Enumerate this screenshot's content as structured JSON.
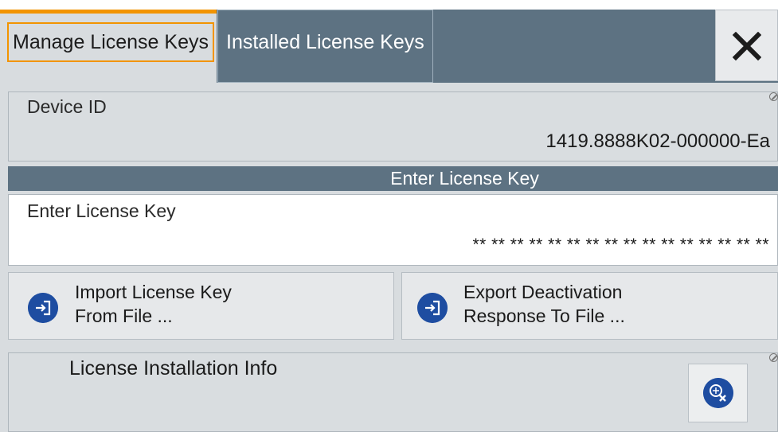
{
  "tabs": [
    {
      "label": "Manage License Keys",
      "active": true
    },
    {
      "label": "Installed License Keys",
      "active": false
    }
  ],
  "close": {
    "icon": "close-icon"
  },
  "device": {
    "label": "Device ID",
    "value": "1419.8888K02-000000-Ea"
  },
  "section_header": "Enter License Key",
  "license_key": {
    "label": "Enter License Key",
    "value": "** ** ** ** ** ** ** ** ** ** ** ** ** ** ** **"
  },
  "buttons": {
    "import": {
      "line1": "Import License Key",
      "line2": "From File ...",
      "icon": "import-file-icon"
    },
    "export": {
      "line1": "Export Deactivation",
      "line2": "Response To File ...",
      "icon": "export-file-icon"
    }
  },
  "install_info": {
    "label": "License Installation Info",
    "clear_icon": "clear-info-icon"
  },
  "colors": {
    "accent": "#f29400",
    "header": "#5d7282",
    "icon_blue": "#1e4da1",
    "panel": "#d8dcdf"
  }
}
